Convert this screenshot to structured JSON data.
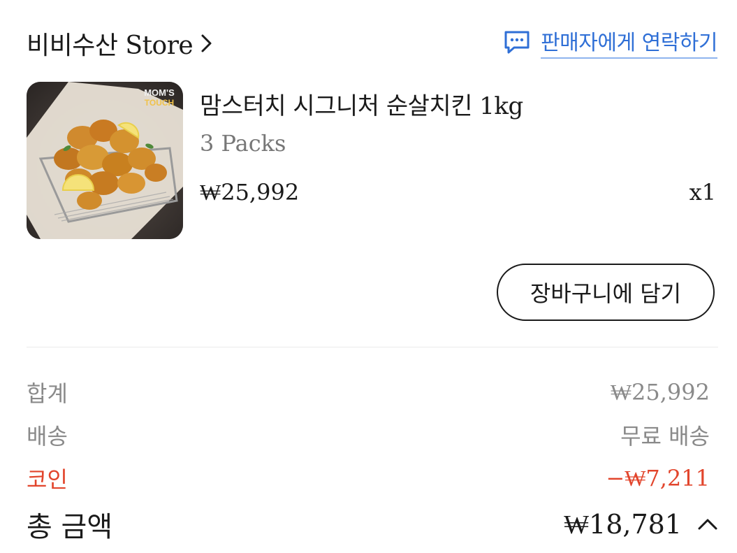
{
  "store": {
    "name": "비비수산 Store"
  },
  "contact": {
    "label": "판매자에게 연락하기"
  },
  "product": {
    "name": "맘스터치 시그니처 순살치킨 1kg",
    "option": "3 Packs",
    "price": "₩25,992",
    "quantity": "x1",
    "image_logo": "MOM'S TOUCH"
  },
  "cart_button": {
    "label": "장바구니에 담기"
  },
  "summary": {
    "subtotal_label": "합계",
    "subtotal_value": "₩25,992",
    "shipping_label": "배송",
    "shipping_value": "무료 배송",
    "coin_label": "코인",
    "coin_value": "−₩7,211",
    "total_label": "총 금액",
    "total_value": "₩18,781"
  },
  "colors": {
    "link": "#2f6fd6",
    "discount": "#e2452c",
    "muted": "#8a8a8a",
    "text": "#1a1a1a"
  },
  "icons": {
    "store_chevron": "chevron-right-icon",
    "contact": "chat-bubble-icon",
    "total_toggle": "chevron-up-icon"
  }
}
